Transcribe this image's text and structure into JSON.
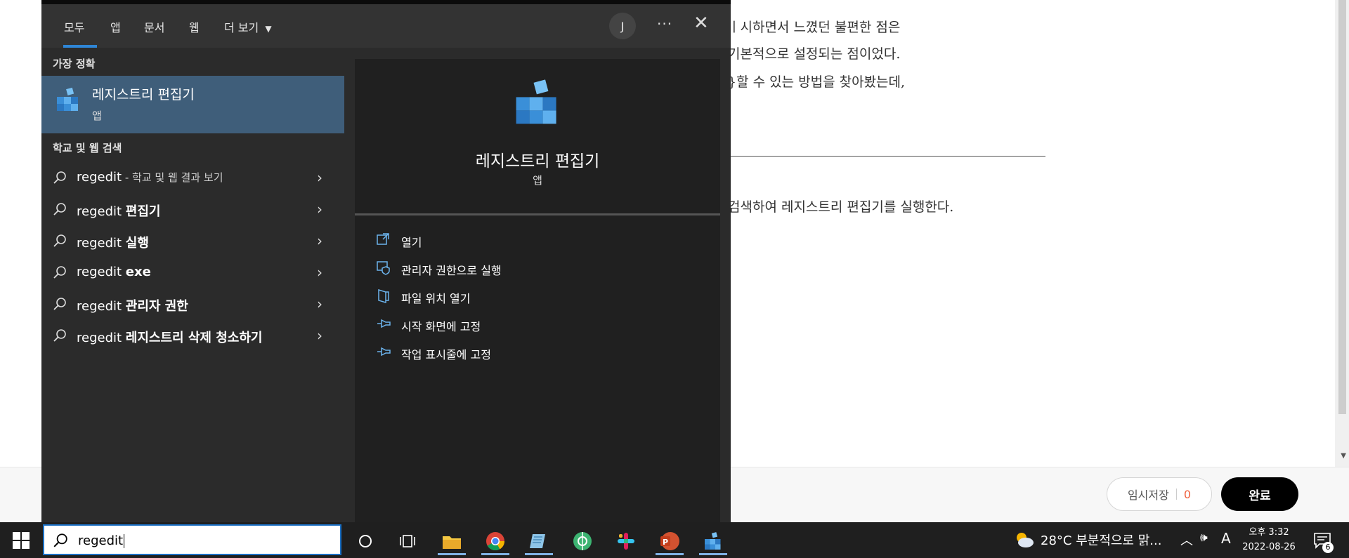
{
  "editor": {
    "line1": "ㅣ시하면서 느꼈던 불편한 점은",
    "line2": "기본적으로 설정되는 점이었다.",
    "line3": "}할 수 있는 방법을 찾아봤는데,",
    "line4": "검색하여 레지스트리 편집기를 실행한다.",
    "draft_label": "임시저장",
    "draft_count": "0",
    "done_label": "완료"
  },
  "search_panel": {
    "tabs": [
      "모두",
      "앱",
      "문서",
      "웹",
      "더 보기"
    ],
    "avatar_initial": "J",
    "more_label": "···",
    "close_label": "✕",
    "best_match_header": "가장 정확",
    "best_match": {
      "title": "레지스트리 편집기",
      "subtitle": "앱"
    },
    "web_header": "학교 및 웹 검색",
    "suggestions": [
      {
        "prefix": "regedit",
        "rest": " - 학교 및 웹 결과 보기"
      },
      {
        "prefix": "regedit ",
        "rest": "편집기"
      },
      {
        "prefix": "regedit ",
        "rest": "실행"
      },
      {
        "prefix": "regedit ",
        "rest": "exe"
      },
      {
        "prefix": "regedit ",
        "rest": "관리자 권한"
      },
      {
        "prefix": "regedit ",
        "rest": "레지스트리 삭제 청소하기"
      }
    ],
    "detail": {
      "title": "레지스트리 편집기",
      "subtitle": "앱",
      "actions": [
        "열기",
        "관리자 권한으로 실행",
        "파일 위치 열기",
        "시작 화면에 고정",
        "작업 표시줄에 고정"
      ]
    }
  },
  "taskbar": {
    "search_value": "regedit",
    "weather": "28°C  부분적으로 맑...",
    "ime": "A",
    "time": "오후 3:32",
    "date": "2022-08-26",
    "notification_count": "6",
    "pinned_icons": [
      "cortana-icon",
      "task-view-icon",
      "file-explorer-icon",
      "chrome-icon",
      "notepad-icon",
      "edge-icon",
      "slack-icon",
      "powerpoint-icon",
      "regedit-icon"
    ]
  },
  "colors": {
    "accent": "#2f86d6",
    "selected_row": "#3f5e7a",
    "panel_bg": "#2b2b2b",
    "taskbar_bg": "#1f1f1f"
  }
}
